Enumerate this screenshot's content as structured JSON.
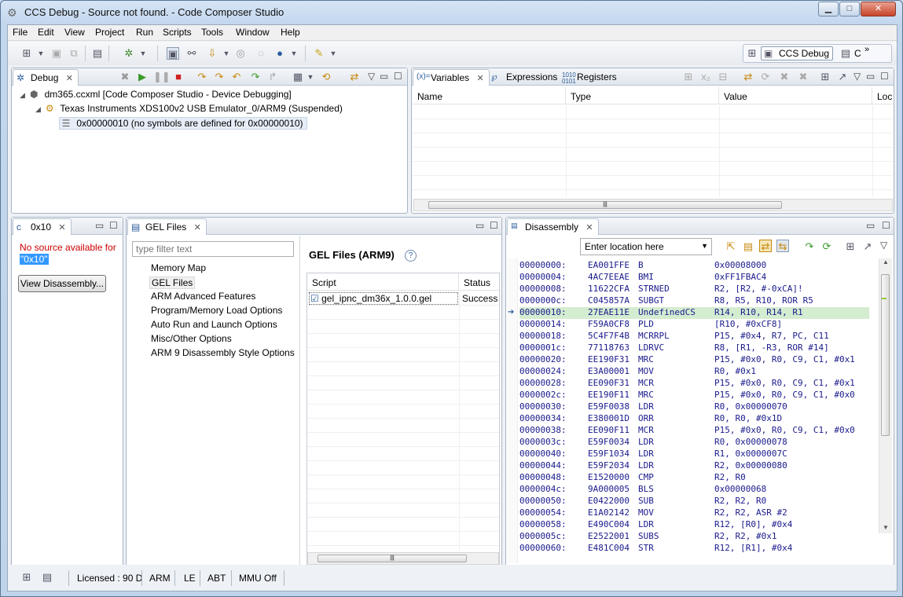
{
  "window": {
    "title": "CCS Debug - Source not found. - Code Composer Studio",
    "minimize_label": "▁",
    "maximize_label": "□",
    "close_label": "✕"
  },
  "menu": [
    "File",
    "Edit",
    "View",
    "Project",
    "Run",
    "Scripts",
    "Tools",
    "Window",
    "Help"
  ],
  "perspective": {
    "active": "CCS Debug",
    "more": "»",
    "other": "C"
  },
  "debug_view": {
    "tab": "Debug",
    "tree": [
      "dm365.ccxml [Code Composer Studio - Device Debugging]",
      "Texas Instruments XDS100v2 USB Emulator_0/ARM9 (Suspended)",
      "0x00000010  (no symbols are defined for 0x00000010)"
    ]
  },
  "variables_view": {
    "tabs": [
      "Variables",
      "Expressions",
      "Registers"
    ],
    "columns": [
      "Name",
      "Type",
      "Value",
      "Loc"
    ],
    "scroll_grip": "|||"
  },
  "source_view": {
    "tab": "0x10",
    "message": "No source available for",
    "address": "\"0x10\"",
    "button": "View Disassembly..."
  },
  "gel_view": {
    "tab": "GEL Files",
    "filter_placeholder": "type filter text",
    "nav_items": [
      "Memory Map",
      "GEL Files",
      "ARM Advanced Features",
      "Program/Memory Load Options",
      "Auto Run and Launch Options",
      "Misc/Other Options",
      "ARM 9 Disassembly Style Options"
    ],
    "selected_nav": "GEL Files",
    "heading": "GEL Files (ARM9)",
    "help": "?",
    "columns": [
      "Script",
      "Status"
    ],
    "rows": [
      {
        "script": "gel_ipnc_dm36x_1.0.0.gel",
        "status": "Success"
      }
    ],
    "scroll_grip": "|||"
  },
  "disassembly_view": {
    "tab": "Disassembly",
    "location_placeholder": "Enter location here",
    "current_address": "00000010:",
    "rows": [
      [
        "00000000:",
        "EA001FFE",
        "B",
        "0x00008000"
      ],
      [
        "00000004:",
        "4AC7EEAE",
        "BMI",
        "0xFF1FBAC4"
      ],
      [
        "00000008:",
        "11622CFA",
        "STRNED",
        "R2, [R2, #-0xCA]!"
      ],
      [
        "0000000c:",
        "C045857A",
        "SUBGT",
        "R8, R5, R10, ROR R5"
      ],
      [
        "00000010:",
        "27EAE11E",
        "UndefinedCS",
        "R14, R10, R14, R1"
      ],
      [
        "00000014:",
        "F59A0CF8",
        "PLD",
        "[R10, #0xCF8]"
      ],
      [
        "00000018:",
        "5C4F7F4B",
        "MCRRPL",
        "P15, #0x4, R7, PC, C11"
      ],
      [
        "0000001c:",
        "77118763",
        "LDRVC",
        "R8, [R1, -R3, ROR #14]"
      ],
      [
        "00000020:",
        "EE190F31",
        "MRC",
        "P15, #0x0, R0, C9, C1, #0x1"
      ],
      [
        "00000024:",
        "E3A00001",
        "MOV",
        "R0, #0x1"
      ],
      [
        "00000028:",
        "EE090F31",
        "MCR",
        "P15, #0x0, R0, C9, C1, #0x1"
      ],
      [
        "0000002c:",
        "EE190F11",
        "MRC",
        "P15, #0x0, R0, C9, C1, #0x0"
      ],
      [
        "00000030:",
        "E59F0038",
        "LDR",
        "R0, 0x00000070"
      ],
      [
        "00000034:",
        "E380001D",
        "ORR",
        "R0, R0, #0x1D"
      ],
      [
        "00000038:",
        "EE090F11",
        "MCR",
        "P15, #0x0, R0, C9, C1, #0x0"
      ],
      [
        "0000003c:",
        "E59F0034",
        "LDR",
        "R0, 0x00000078"
      ],
      [
        "00000040:",
        "E59F1034",
        "LDR",
        "R1, 0x0000007C"
      ],
      [
        "00000044:",
        "E59F2034",
        "LDR",
        "R2, 0x00000080"
      ],
      [
        "00000048:",
        "E1520000",
        "CMP",
        "R2, R0"
      ],
      [
        "0000004c:",
        "9A000005",
        "BLS",
        "0x00000068"
      ],
      [
        "00000050:",
        "E0422000",
        "SUB",
        "R2, R2, R0"
      ],
      [
        "00000054:",
        "E1A02142",
        "MOV",
        "R2, R2, ASR #2"
      ],
      [
        "00000058:",
        "E490C004",
        "LDR",
        "R12, [R0], #0x4"
      ],
      [
        "0000005c:",
        "E2522001",
        "SUBS",
        "R2, R2, #0x1"
      ],
      [
        "00000060:",
        "E481C004",
        "STR",
        "R12, [R1], #0x4"
      ]
    ]
  },
  "status_bar": [
    "Licensed : 90 D",
    "ARM",
    "LE",
    "ABT",
    "MMU Off"
  ],
  "colors": {
    "highlight_row": "#d4ecd0",
    "selected": "#3399ff",
    "error_text": "#cc0000",
    "asm_text": "#1a1a8c"
  }
}
